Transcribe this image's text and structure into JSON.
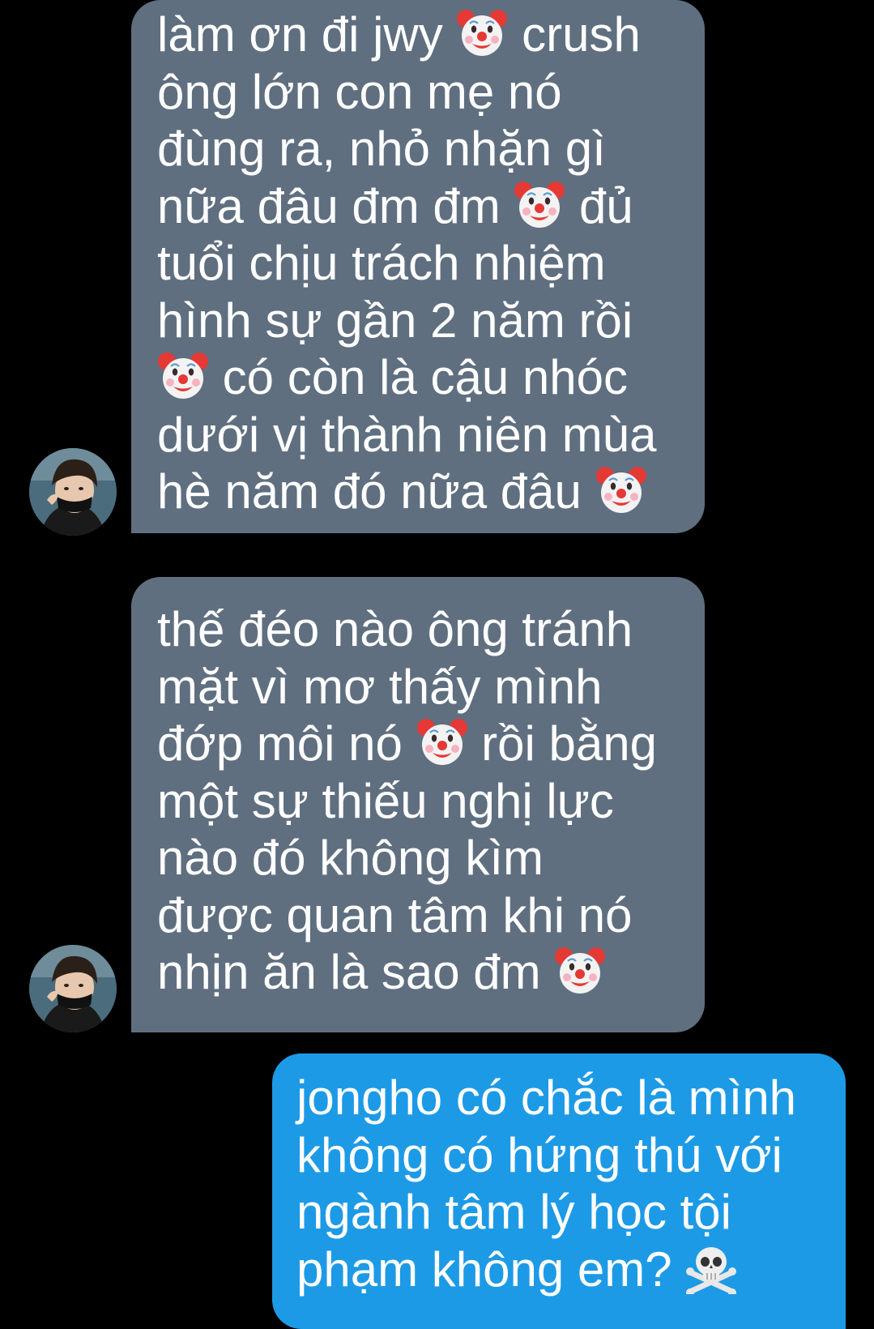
{
  "colors": {
    "background": "#000000",
    "incoming_bubble": "#5f6f80",
    "outgoing_bubble": "#1d9ae6",
    "text": "#ffffff"
  },
  "messages": [
    {
      "direction": "incoming",
      "lines": [
        {
          "segments": [
            {
              "text": "làm ơn đi jwy "
            },
            {
              "emoji": "clown-face-icon"
            },
            {
              "text": " crush"
            }
          ]
        },
        {
          "segments": [
            {
              "text": "ông lớn con mẹ nó"
            }
          ]
        },
        {
          "segments": [
            {
              "text": "đùng ra, nhỏ nhặn gì"
            }
          ]
        },
        {
          "segments": [
            {
              "text": "nữa đâu đm đm "
            },
            {
              "emoji": "clown-face-icon"
            },
            {
              "text": " đủ"
            }
          ]
        },
        {
          "segments": [
            {
              "text": "tuổi chịu trách nhiệm"
            }
          ]
        },
        {
          "segments": [
            {
              "text": "hình sự gần 2 năm rồi"
            }
          ]
        },
        {
          "segments": [
            {
              "emoji": "clown-face-icon"
            },
            {
              "text": " có còn là cậu nhóc"
            }
          ]
        },
        {
          "segments": [
            {
              "text": "dưới vị thành niên mùa"
            }
          ]
        },
        {
          "segments": [
            {
              "text": "hè năm đó nữa đâu "
            },
            {
              "emoji": "clown-face-icon"
            }
          ]
        }
      ],
      "avatar": "avatar-jongho"
    },
    {
      "direction": "incoming",
      "lines": [
        {
          "segments": [
            {
              "text": "thế đéo nào ông tránh"
            }
          ]
        },
        {
          "segments": [
            {
              "text": "mặt vì mơ thấy mình"
            }
          ]
        },
        {
          "segments": [
            {
              "text": "đớp môi nó "
            },
            {
              "emoji": "clown-face-icon"
            },
            {
              "text": " rồi bằng"
            }
          ]
        },
        {
          "segments": [
            {
              "text": "một sự thiếu nghị lực"
            }
          ]
        },
        {
          "segments": [
            {
              "text": "nào đó không kìm"
            }
          ]
        },
        {
          "segments": [
            {
              "text": "được quan tâm khi nó"
            }
          ]
        },
        {
          "segments": [
            {
              "text": "nhịn ăn là sao đm "
            },
            {
              "emoji": "clown-face-icon"
            }
          ]
        }
      ],
      "avatar": "avatar-jongho"
    },
    {
      "direction": "outgoing",
      "lines": [
        {
          "segments": [
            {
              "text": "jongho có chắc là mình"
            }
          ]
        },
        {
          "segments": [
            {
              "text": "không có hứng thú với"
            }
          ]
        },
        {
          "segments": [
            {
              "text": "ngành tâm lý học tội"
            }
          ]
        },
        {
          "segments": [
            {
              "text": "phạm không em? "
            },
            {
              "emoji": "skull-and-crossbones-icon"
            }
          ]
        }
      ]
    }
  ]
}
